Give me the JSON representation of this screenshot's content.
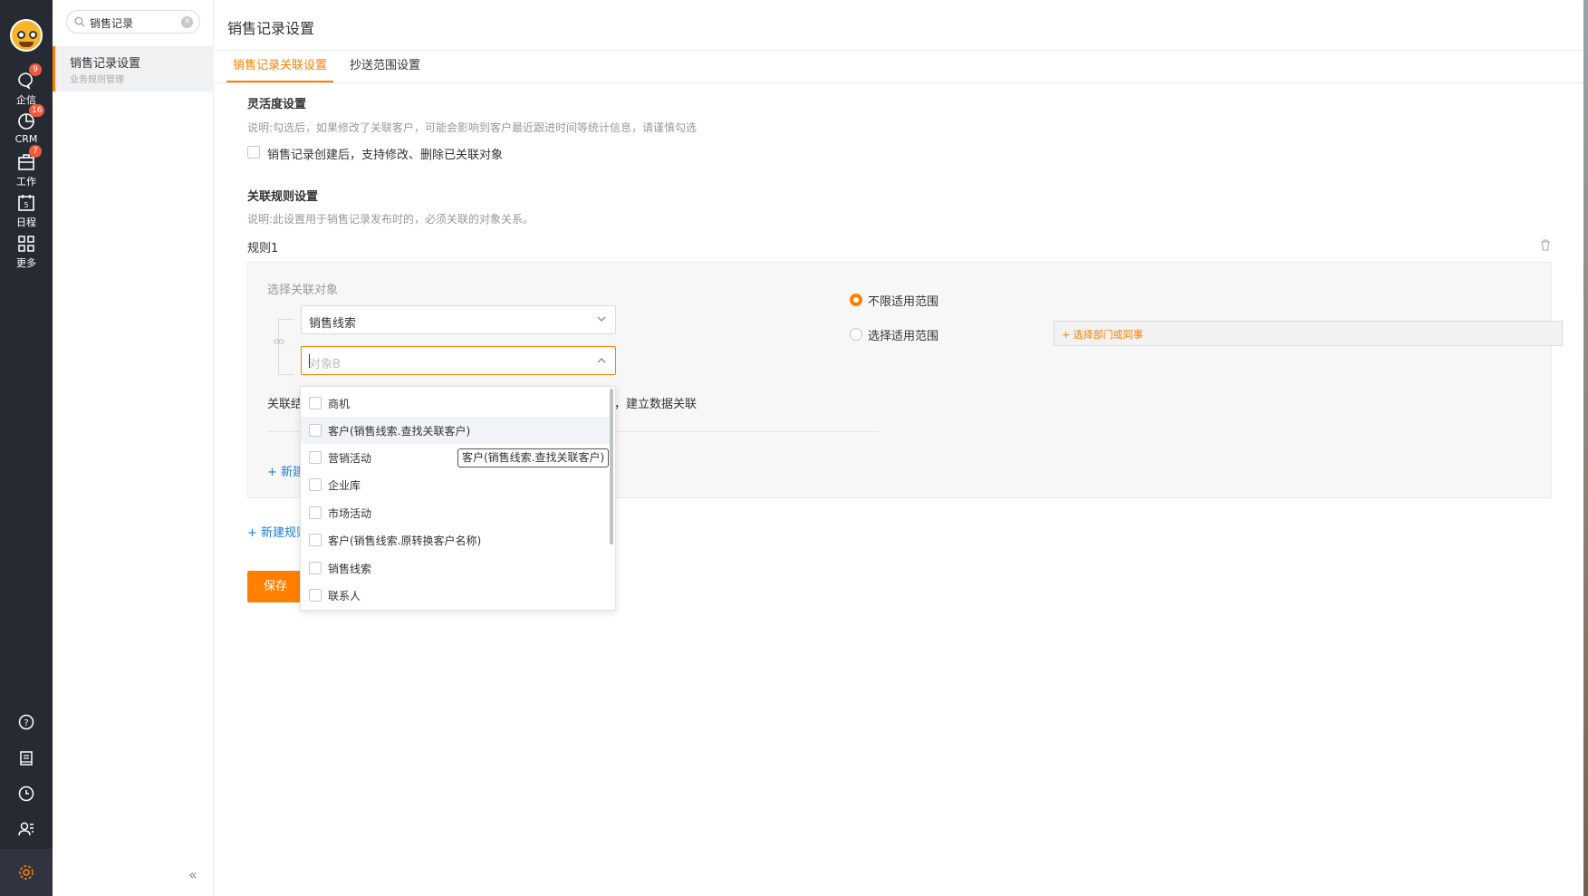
{
  "rail": {
    "items": [
      {
        "label": "企信",
        "badge": "9"
      },
      {
        "label": "CRM",
        "badge": "16"
      },
      {
        "label": "工作",
        "badge": "7"
      },
      {
        "label": "日程",
        "badge": ""
      },
      {
        "label": "更多",
        "badge": ""
      }
    ]
  },
  "panel": {
    "search_value": "销售记录",
    "item_title": "销售记录设置",
    "item_subtitle": "业务规则管理"
  },
  "page": {
    "title": "销售记录设置",
    "tabs": [
      "销售记录关联设置",
      "抄送范围设置"
    ]
  },
  "flex": {
    "title": "灵活度设置",
    "note": "说明:勾选后，如果修改了关联客户，可能会影响到客户最近跟进时间等统计信息，请谨慎勾选",
    "checkbox_label": "销售记录创建后，支持修改、删除已关联对象"
  },
  "rules": {
    "title": "关联规则设置",
    "note": "说明:此设置用于销售记录发布时的，必须关联的对象关系。",
    "rule_name": "规则1",
    "select_object_label": "选择关联对象",
    "first_select_value": "销售线索",
    "second_select_placeholder": "对象B",
    "relation_prefix": "关联结",
    "relation_suffix": "，建立数据关联",
    "add_inner": "+ 新建",
    "add_rule": "+ 新建规则",
    "scope_unlimited": "不限适用范围",
    "scope_select": "选择适用范围",
    "scope_placeholder": "+ 选择部门或同事"
  },
  "save_label": "保存",
  "dropdown": {
    "options": [
      "商机",
      "客户(销售线索.查找关联客户)",
      "营销活动",
      "企业库",
      "市场活动",
      "客户(销售线索.原转换客户名称)",
      "销售线索",
      "联系人"
    ],
    "tooltip": "客户(销售线索.查找关联客户)"
  },
  "colors": {
    "accent": "#ff8000",
    "rail_bg": "#262a33",
    "link": "#1b7fe0"
  }
}
